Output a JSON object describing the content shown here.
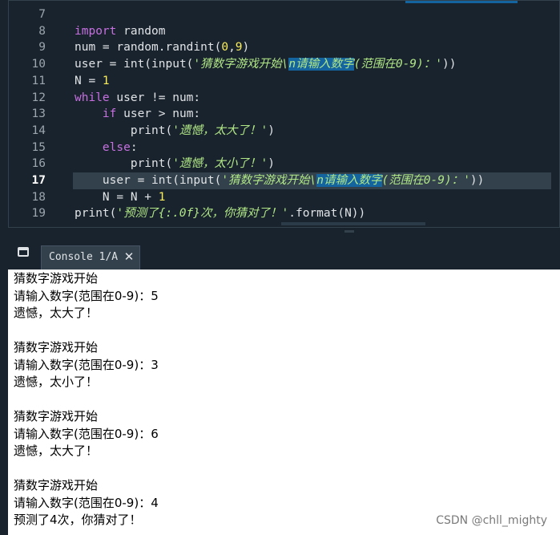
{
  "editor": {
    "lines": [
      {
        "n": "7",
        "parts": []
      },
      {
        "n": "8",
        "parts": [
          {
            "t": "kw",
            "v": "import"
          },
          {
            "t": "",
            "v": " random"
          }
        ]
      },
      {
        "n": "9",
        "parts": [
          {
            "t": "",
            "v": "num = random.randint("
          },
          {
            "t": "num-lit",
            "v": "0"
          },
          {
            "t": "",
            "v": ","
          },
          {
            "t": "num-lit",
            "v": "9"
          },
          {
            "t": "",
            "v": ")"
          }
        ]
      },
      {
        "n": "10",
        "parts": [
          {
            "t": "",
            "v": "user = int(input("
          },
          {
            "t": "str",
            "v": "'猜数字游戏开始\\"
          },
          {
            "t": "str sel",
            "v": "n请输入数字"
          },
          {
            "t": "str",
            "v": "(范围在0-9)："
          },
          {
            "t": "str",
            "v": "'"
          },
          {
            "t": "",
            "v": "))"
          }
        ]
      },
      {
        "n": "11",
        "parts": [
          {
            "t": "",
            "v": "N = "
          },
          {
            "t": "num-lit",
            "v": "1"
          }
        ]
      },
      {
        "n": "12",
        "parts": [
          {
            "t": "kw",
            "v": "while"
          },
          {
            "t": "",
            "v": " user != num:"
          }
        ]
      },
      {
        "n": "13",
        "parts": [
          {
            "t": "",
            "v": "    "
          },
          {
            "t": "kw",
            "v": "if"
          },
          {
            "t": "",
            "v": " user > num:"
          }
        ]
      },
      {
        "n": "14",
        "parts": [
          {
            "t": "",
            "v": "        print("
          },
          {
            "t": "str",
            "v": "'遗憾，太大了！'"
          },
          {
            "t": "",
            "v": ")"
          }
        ]
      },
      {
        "n": "15",
        "parts": [
          {
            "t": "",
            "v": "    "
          },
          {
            "t": "kw",
            "v": "else"
          },
          {
            "t": "",
            "v": ":"
          }
        ]
      },
      {
        "n": "16",
        "parts": [
          {
            "t": "",
            "v": "        print("
          },
          {
            "t": "str",
            "v": "'遗憾，太小了！'"
          },
          {
            "t": "",
            "v": ")"
          }
        ]
      },
      {
        "n": "17",
        "current": true,
        "parts": [
          {
            "t": "",
            "v": "    user = int(input("
          },
          {
            "t": "str",
            "v": "'猜数字游戏开始\\"
          },
          {
            "t": "str sel",
            "v": "n请输入数字"
          },
          {
            "t": "str",
            "v": "(范围在0-9)："
          },
          {
            "t": "str",
            "v": "'"
          },
          {
            "t": "",
            "v": "))"
          }
        ]
      },
      {
        "n": "18",
        "parts": [
          {
            "t": "",
            "v": "    N = N + "
          },
          {
            "t": "num-lit",
            "v": "1"
          }
        ]
      },
      {
        "n": "19",
        "parts": [
          {
            "t": "",
            "v": "print("
          },
          {
            "t": "str",
            "v": "'预测了{:.0f}次，你猜对了！'"
          },
          {
            "t": "",
            "v": ".format(N))"
          }
        ]
      }
    ]
  },
  "console": {
    "tab_label": "Console 1/A",
    "close_glyph": "✕",
    "output": [
      "猜数字游戏开始",
      "请输入数字(范围在0-9)：5",
      "遗憾，太大了！",
      "",
      "猜数字游戏开始",
      "请输入数字(范围在0-9)：3",
      "遗憾，太小了！",
      "",
      "猜数字游戏开始",
      "请输入数字(范围在0-9)：6",
      "遗憾，太大了！",
      "",
      "猜数字游戏开始",
      "请输入数字(范围在0-9)：4",
      "预测了4次，你猜对了！"
    ]
  },
  "watermark": "CSDN @chll_mighty",
  "icons": {
    "pane": "window-icon",
    "close": "close-icon"
  },
  "colors": {
    "background": "#19232d",
    "keyword": "#c670e0",
    "string": "#b0e686",
    "number": "#faed5c",
    "selection": "#1464a0"
  }
}
